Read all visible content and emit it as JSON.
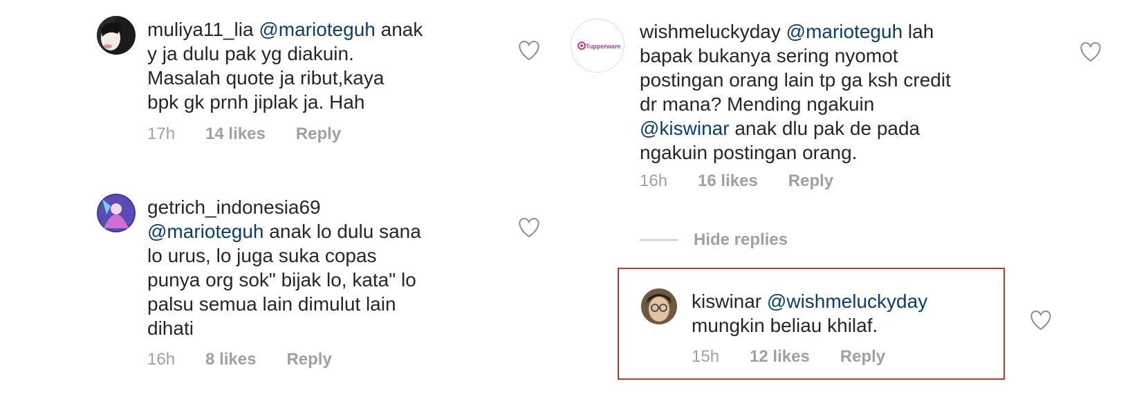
{
  "left_comments": [
    {
      "username": "muliya11_lia",
      "mention": "@marioteguh",
      "text_lines": [
        " anak",
        "y ja dulu pak yg diakuin.",
        "Masalah quote ja ribut,kaya",
        "bpk gk prnh jiplak ja. Hah"
      ],
      "time": "17h",
      "likes": "14 likes",
      "reply": "Reply"
    },
    {
      "username": "getrich_indonesia69",
      "mention": "@marioteguh",
      "text_lines": [
        " anak lo dulu sana",
        "lo urus, lo juga suka copas",
        "punya org sok\" bijak lo, kata\" lo",
        "palsu semua lain dimulut lain",
        "dihati"
      ],
      "time": "16h",
      "likes": "8 likes",
      "reply": "Reply"
    }
  ],
  "right_comment": {
    "username": "wishmeluckyday",
    "mention": "@marioteguh",
    "text_before_mention2": [
      " lah",
      "bapak bukanya sering nyomot",
      "postingan orang lain tp ga ksh credit",
      "dr mana?  Mending ngakuin"
    ],
    "mention2": "@kiswinar",
    "text_after_mention2": [
      " anak dlu pak de pada",
      "ngakuin postingan orang."
    ],
    "time": "16h",
    "likes": "16 likes",
    "reply": "Reply",
    "avatar_logo_text": "Tupperware"
  },
  "hide_replies": "Hide replies",
  "reply_comment": {
    "username": "kiswinar",
    "mention": "@wishmeluckyday",
    "text_lines": [
      "mungkin beliau khilaf."
    ],
    "time": "15h",
    "likes": "12 likes",
    "reply": "Reply"
  },
  "colors": {
    "mention": "#0a3e6e",
    "meta_gray": "#a0a0a0",
    "highlight_border": "#c0392b",
    "tupperware_pink": "#c4359a"
  },
  "icons": [
    "heart-icon"
  ]
}
